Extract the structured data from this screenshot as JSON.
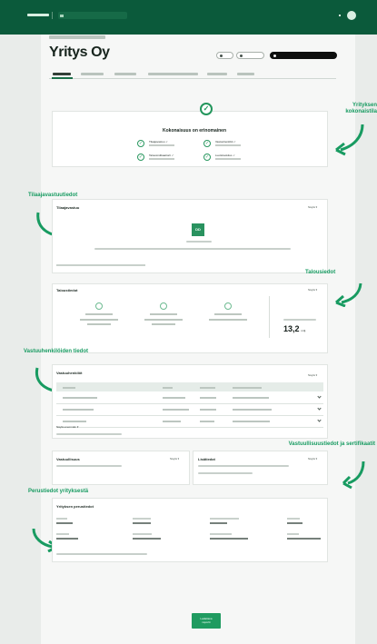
{
  "company": {
    "title": "Yritys Oy"
  },
  "summary": {
    "title": "Kokonaisuus on erinomainen",
    "items": [
      {
        "label": "Tilaajavastuu ✓"
      },
      {
        "label": "Vastuuhenkilöt ✓"
      },
      {
        "label": "Talousindikaattorit ✓"
      },
      {
        "label": "Luottoluokitus ✓"
      }
    ]
  },
  "callouts": {
    "company_overall": "Yrityksen kokonaistila",
    "contractor_info": "Tilaajavastuutiedot",
    "financial_info": "Talousiedot",
    "responsible_people": "Vastuuhenkilöiden tiedot",
    "certifications": "Vastuullisuustiedot ja sertifikaatit",
    "basic_info": "Perustiedot yrityksestä"
  },
  "contractor_card": {
    "title": "Tilaajavastuu",
    "more": "Näytä ▾",
    "logo_text": "DD"
  },
  "finance_card": {
    "title": "Taloustiedot",
    "more": "Näytä ▾",
    "big_value": "13,2",
    "big_unit": "milj."
  },
  "responsible_card": {
    "title": "Vastuuhenkilöt",
    "more": "Näytä ▾",
    "more_link": "Näytä enemmän ▾"
  },
  "small_cards": {
    "left_title": "Vastuullisuus",
    "left_more": "Näytä ▾",
    "right_title": "Lisätiedot",
    "right_more": "Näytä ▾"
  },
  "base_card": {
    "title": "Yrityksen perustiedot"
  },
  "footer": {
    "button_line1": "Ladattava",
    "button_line2": "raportti"
  }
}
